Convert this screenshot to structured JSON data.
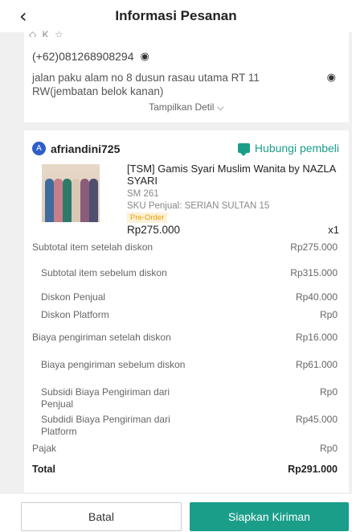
{
  "header": {
    "title": "Informasi Pesanan",
    "back_icon": "‹"
  },
  "address": {
    "clipped_name": "◇ K   ☆",
    "phone": "(+62)081268908294",
    "address": "jalan paku alam no 8 dusun rasau utama RT 11 RW(jembatan belok kanan)",
    "detail_label": "Tampilkan Detil ⌵"
  },
  "order": {
    "buyer_initial": "A",
    "buyer_name": "afriandini725",
    "contact_label": "Hubungi pembeli",
    "product_name": "[TSM] Gamis Syari Muslim Wanita by NAZLA SYARI",
    "variant": "SM 261",
    "seller_sku": "SKU Penjual: SERIAN SULTAN 15",
    "badge": "Pre-Order",
    "price": "Rp275.000",
    "quantity": "x1",
    "thumb_colors": [
      "#3f6b9e",
      "#c77d8a",
      "#2d7a6a",
      "#d9c8b3",
      "#8a5c7a",
      "#4f4f6e"
    ]
  },
  "summary": [
    {
      "label": "Subtotal item setelah diskon",
      "value": "Rp275.000",
      "sub": false
    },
    {
      "label": "Subtotal item sebelum diskon",
      "value": "Rp315.000",
      "sub": true
    },
    {
      "label": "Diskon Penjual",
      "value": "Rp40.000",
      "sub": true
    },
    {
      "label": "Diskon Platform",
      "value": "Rp0",
      "sub": true
    },
    {
      "label": "Biaya pengiriman setelah diskon",
      "value": "Rp16.000",
      "sub": false
    },
    {
      "label": "Biaya pengiriman sebelum diskon",
      "value": "Rp61.000",
      "sub": true
    },
    {
      "label": "Subsidi Biaya Pengiriman dari Penjual",
      "value": "Rp0",
      "sub": true
    },
    {
      "label": "Subdidi Biaya Pengiriman dari Platform",
      "value": "Rp45.000",
      "sub": true
    },
    {
      "label": "Pajak",
      "value": "Rp0",
      "sub": false
    },
    {
      "label": "Total",
      "value": "Rp291.000",
      "sub": false
    }
  ],
  "footer": {
    "cancel_label": "Batal",
    "ship_label": "Siapkan Kiriman"
  },
  "colors": {
    "accent": "#1a9e8a",
    "avatar": "#2f5ec9",
    "preorder": "#e8a100"
  }
}
